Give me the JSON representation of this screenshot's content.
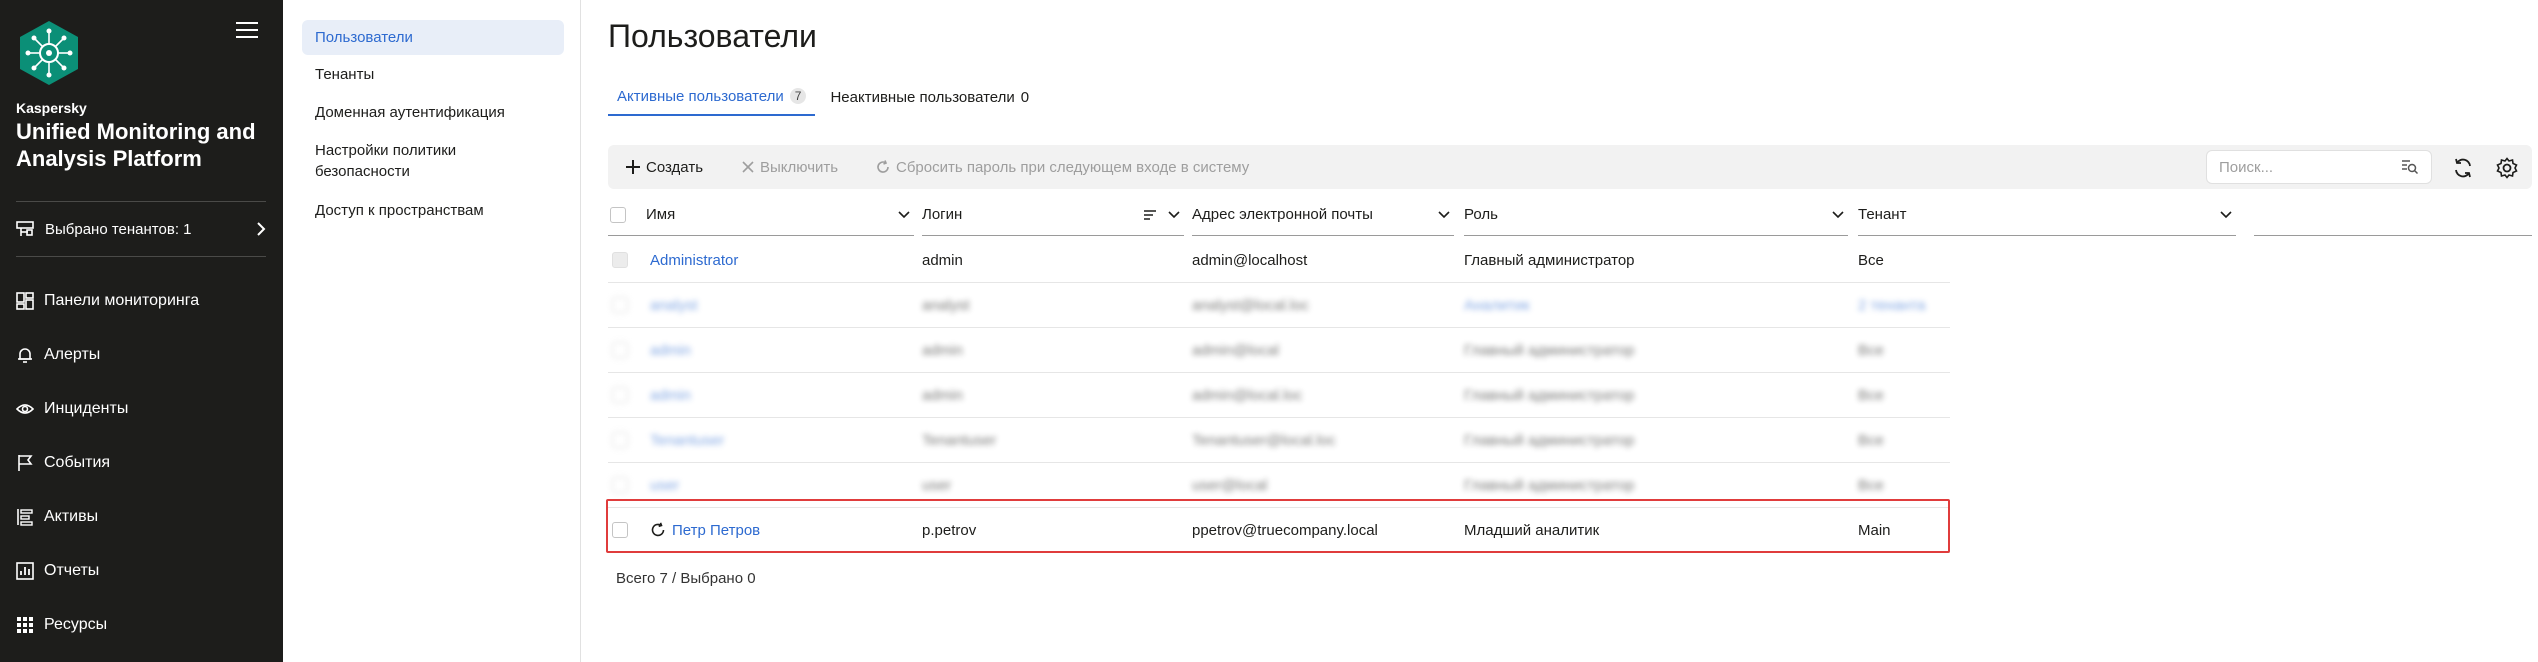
{
  "brand": {
    "company": "Kaspersky",
    "product": "Unified Monitoring and Analysis Platform"
  },
  "sidebar": {
    "tenant_selector": "Выбрано тенантов: 1",
    "items": [
      {
        "label": "Панели мониторинга",
        "icon": "dashboard-icon"
      },
      {
        "label": "Алерты",
        "icon": "bell-icon"
      },
      {
        "label": "Инциденты",
        "icon": "eye-icon"
      },
      {
        "label": "События",
        "icon": "flag-icon"
      },
      {
        "label": "Активы",
        "icon": "assets-icon"
      },
      {
        "label": "Отчеты",
        "icon": "report-icon"
      },
      {
        "label": "Ресурсы",
        "icon": "grid-icon"
      }
    ]
  },
  "subnav": {
    "items": [
      {
        "label": "Пользователи",
        "active": true
      },
      {
        "label": "Тенанты"
      },
      {
        "label": "Доменная аутентификация"
      },
      {
        "label": "Настройки политики безопасности"
      },
      {
        "label": "Доступ к пространствам"
      }
    ]
  },
  "page": {
    "title": "Пользователи"
  },
  "tabs": [
    {
      "label": "Активные пользователи",
      "count": "7",
      "active": true
    },
    {
      "label": "Неактивные пользователи",
      "count": "0"
    }
  ],
  "toolbar": {
    "create": "Создать",
    "disable": "Выключить",
    "reset_password": "Сбросить пароль при следующем входе в систему",
    "search_placeholder": "Поиск..."
  },
  "table": {
    "columns": [
      "Имя",
      "Логин",
      "Адрес электронной почты",
      "Роль",
      "Тенант"
    ],
    "rows": [
      {
        "name": "Administrator",
        "login": "admin",
        "email": "admin@localhost",
        "role": "Главный администратор",
        "tenant": "Все",
        "blurred": false
      },
      {
        "name": "analyst",
        "login": "analyst",
        "email": "analyst@local.loc",
        "role": "Аналитик",
        "tenant": "2 тенанта",
        "blurred": true
      },
      {
        "name": "admin",
        "login": "admin",
        "email": "admin@local",
        "role": "Главный администратор",
        "tenant": "Все",
        "blurred": true
      },
      {
        "name": "admin",
        "login": "admin",
        "email": "admin@local.loc",
        "role": "Главный администратор",
        "tenant": "Все",
        "blurred": true
      },
      {
        "name": "Tenantuser",
        "login": "Tenantuser",
        "email": "Tenantuser@local.loc",
        "role": "Главный администратор",
        "tenant": "Все",
        "blurred": true
      },
      {
        "name": "user",
        "login": "user",
        "email": "user@local",
        "role": "Главный администратор",
        "tenant": "Все",
        "blurred": true
      },
      {
        "name": "Петр Петров",
        "login": "p.petrov",
        "email": "ppetrov@truecompany.local",
        "role": "Младший аналитик",
        "tenant": "Main",
        "blurred": false
      }
    ]
  },
  "footer": {
    "summary": "Всего 7 / Выбрано 0"
  },
  "colors": {
    "sidebar_bg": "#1d1d1b",
    "accent": "#2d6ad0",
    "highlight": "#e03c3c"
  }
}
